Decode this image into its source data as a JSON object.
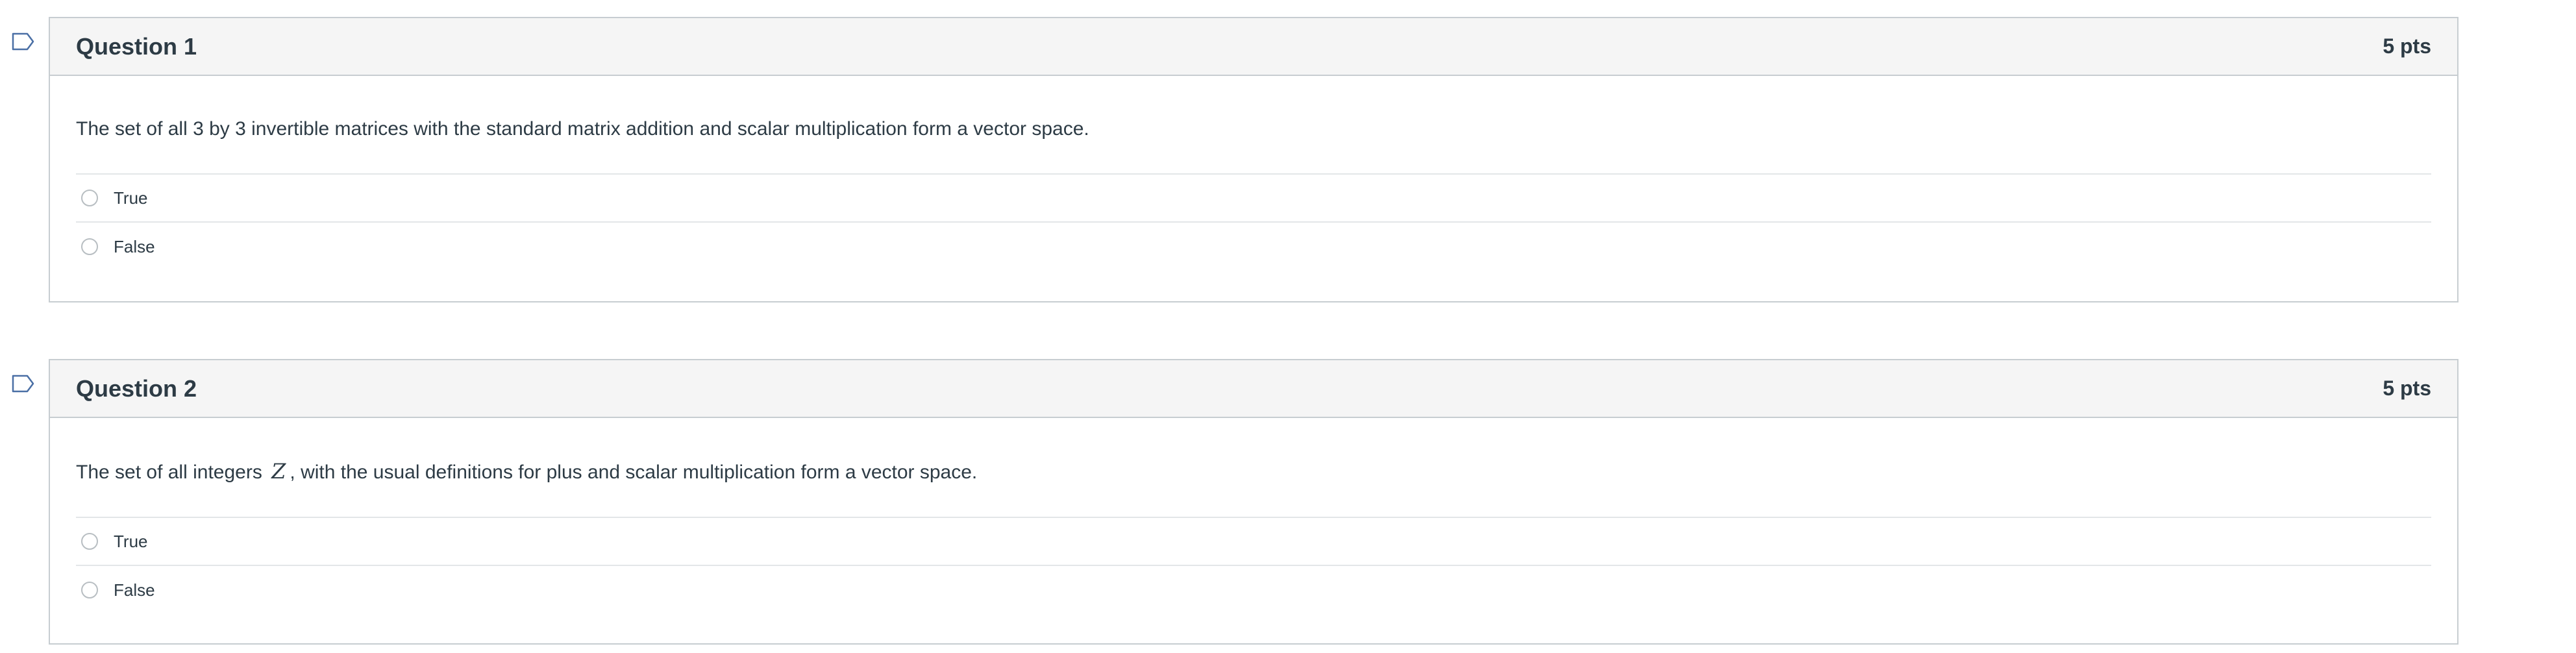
{
  "questions": [
    {
      "title": "Question 1",
      "points": "5 pts",
      "text_before": "The set of all 3 by 3 invertible matrices with the standard matrix addition and scalar multiplication form a vector space.",
      "math": "",
      "text_after": "",
      "answers": [
        "True",
        "False"
      ]
    },
    {
      "title": "Question 2",
      "points": "5 pts",
      "text_before": "The set of all integers",
      "math": "Z",
      "text_after": ", with the usual definitions for plus and scalar multiplication form a vector space.",
      "answers": [
        "True",
        "False"
      ]
    }
  ],
  "icons": {
    "flag": "flag-question-icon",
    "radio": "radio-button"
  },
  "colors": {
    "header_bg": "#f5f5f5",
    "border": "#c7cdd1",
    "divider": "#e3e6e8",
    "text": "#2d3b45",
    "flag_stroke": "#4a6fa5"
  }
}
